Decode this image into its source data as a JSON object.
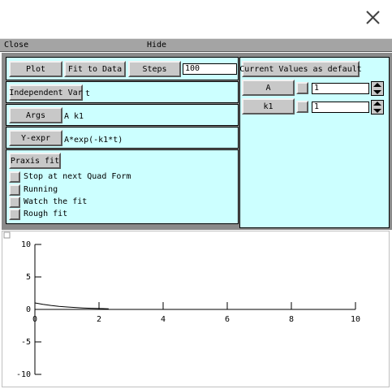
{
  "window": {
    "close_icon": "close-x-icon"
  },
  "menubar": {
    "close_label": "Close",
    "hide_label": "Hide"
  },
  "controls": {
    "plot_label": "Plot",
    "fit_to_data_label": "Fit to Data",
    "steps_label": "Steps",
    "steps_value": "100",
    "independent_var_label": "Independent Var",
    "independent_var_value": "t",
    "args_label": "Args",
    "args_value": "A k1",
    "yexpr_label": "Y-expr",
    "yexpr_value": "A*exp(-k1*t)",
    "praxis_fit_label": "Praxis fit",
    "checkboxes": [
      {
        "label": "Stop at next Quad Form"
      },
      {
        "label": "Running"
      },
      {
        "label": "Watch the fit"
      },
      {
        "label": "Rough fit"
      }
    ]
  },
  "params": {
    "defaults_label": "Current Values as default",
    "items": [
      {
        "name": "A",
        "value": "1"
      },
      {
        "name": "k1",
        "value": "1"
      }
    ]
  },
  "chart_data": {
    "type": "line",
    "title": "",
    "xlabel": "",
    "ylabel": "",
    "xlim": [
      0,
      10
    ],
    "ylim": [
      -10,
      10
    ],
    "xticks": [
      0,
      2,
      4,
      6,
      8,
      10
    ],
    "yticks": [
      10,
      5,
      0,
      -5,
      -10
    ],
    "series": [
      {
        "x": [
          0,
          0.25,
          0.5,
          0.75,
          1.0,
          1.25,
          1.5,
          1.75,
          2.0,
          2.3
        ],
        "y": [
          1.0,
          0.78,
          0.61,
          0.47,
          0.37,
          0.29,
          0.22,
          0.17,
          0.14,
          0.1
        ]
      }
    ],
    "line_color": "#000000"
  }
}
